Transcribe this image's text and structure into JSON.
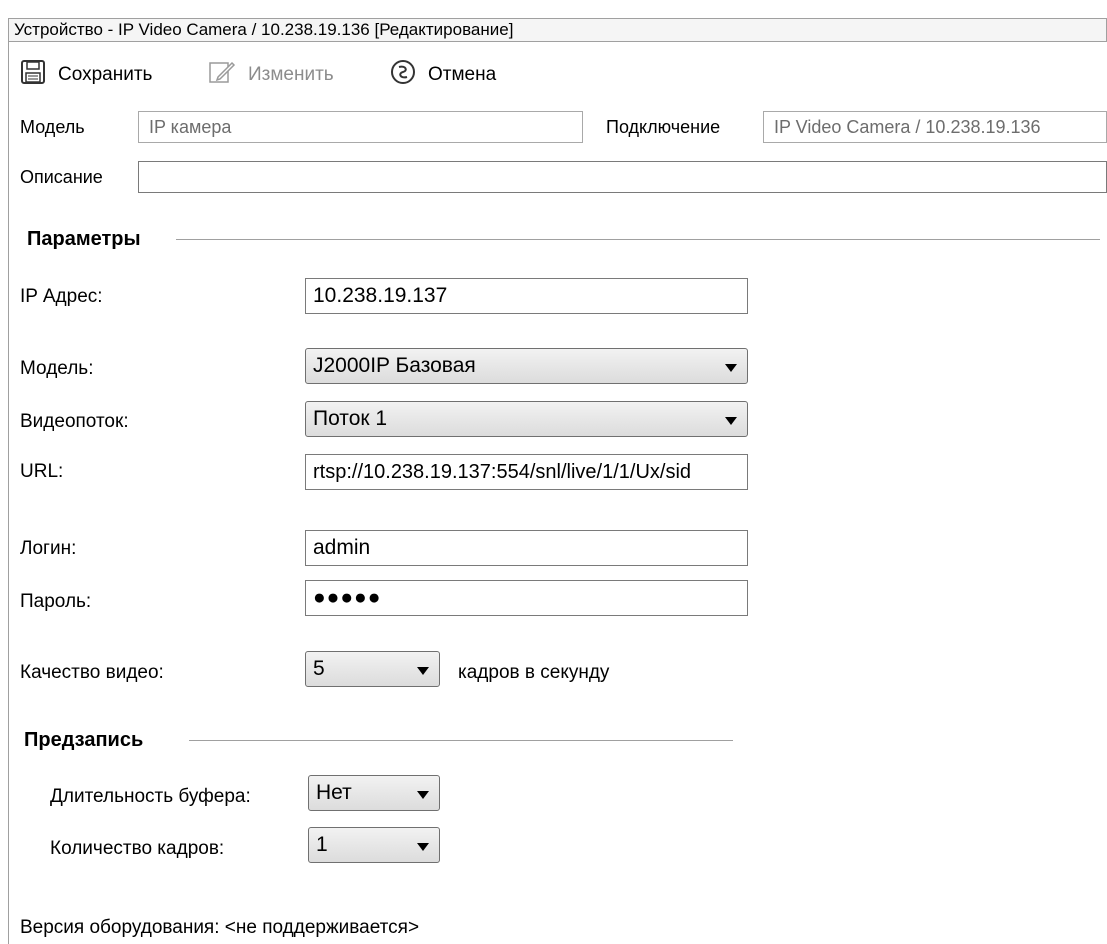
{
  "window": {
    "title": "Устройство - IP Video Camera / 10.238.19.136 [Редактирование]"
  },
  "toolbar": {
    "save_label": "Сохранить",
    "edit_label": "Изменить",
    "cancel_label": "Отмена",
    "save_icon": "floppy-disk-icon",
    "edit_icon": "pencil-icon",
    "cancel_icon": "cancel-circle-icon"
  },
  "header": {
    "model_label": "Модель",
    "model_value": "IP камера",
    "connection_label": "Подключение",
    "connection_value": "IP Video Camera / 10.238.19.136",
    "description_label": "Описание",
    "description_value": ""
  },
  "params": {
    "section_title": "Параметры",
    "ip_label": "IP Адрес:",
    "ip_value": "10.238.19.137",
    "model_label": "Модель:",
    "model_value": "J2000IP Базовая",
    "stream_label": "Видеопоток:",
    "stream_value": "Поток 1",
    "url_label": "URL:",
    "url_value": "rtsp://10.238.19.137:554/snl/live/1/1/Ux/sid",
    "login_label": "Логин:",
    "login_value": "admin",
    "password_label": "Пароль:",
    "password_value": "●●●●●",
    "quality_label": "Качество видео:",
    "quality_value": "5",
    "quality_unit": "кадров в секунду"
  },
  "prerecord": {
    "section_title": "Предзапись",
    "buffer_label": "Длительность буфера:",
    "buffer_value": "Нет",
    "frames_label": "Количество кадров:",
    "frames_value": "1"
  },
  "footer": {
    "hw_version": "Версия оборудования: <не поддерживается>"
  }
}
